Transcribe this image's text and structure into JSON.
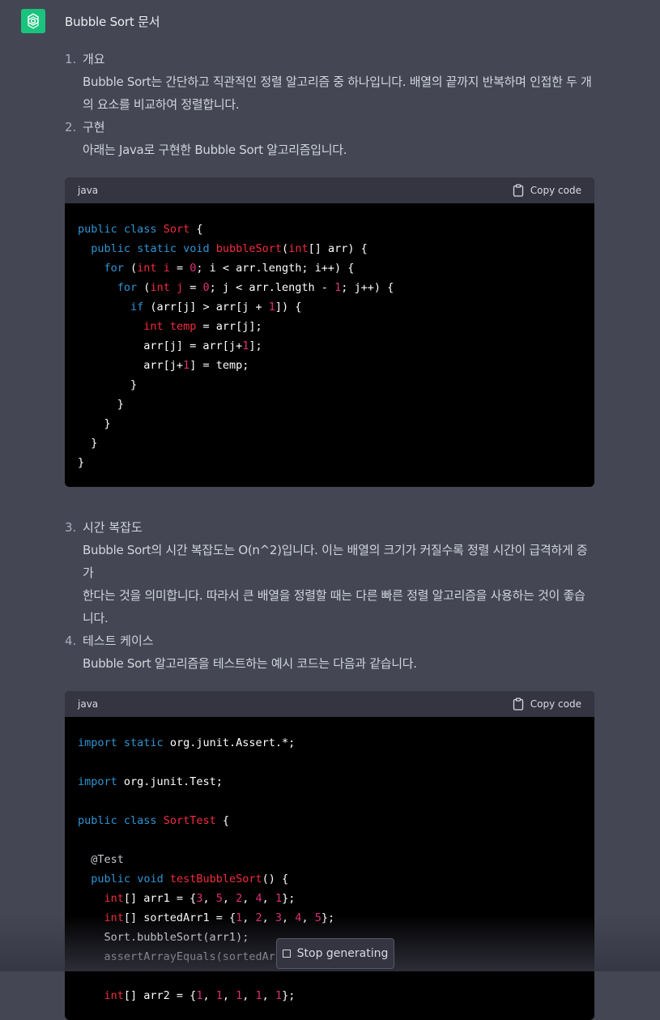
{
  "header": {
    "title": "Bubble Sort 문서",
    "logo_icon": "openai-logo-icon"
  },
  "sections": [
    {
      "num": "1.",
      "heading": "개요",
      "lines": [
        "Bubble Sort는 간단하고 직관적인 정렬 알고리즘 중 하나입니다. 배열의 끝까지 반복하며 인접한 두 개",
        "의 요소를 비교하여 정렬합니다."
      ]
    },
    {
      "num": "2.",
      "heading": "구현",
      "lines": [
        "아래는 Java로 구현한 Bubble Sort 알고리즘입니다."
      ]
    },
    {
      "num": "3.",
      "heading": "시간 복잡도",
      "lines": [
        "Bubble Sort의 시간 복잡도는 O(n^2)입니다. 이는 배열의 크기가 커질수록 정렬 시간이 급격하게 증가",
        "한다는 것을 의미합니다. 따라서 큰 배열을 정렬할 때는 다른 빠른 정렬 알고리즘을 사용하는 것이 좋습",
        "니다."
      ]
    },
    {
      "num": "4.",
      "heading": "테스트 케이스",
      "lines": [
        "Bubble Sort 알고리즘을 테스트하는 예시 코드는 다음과 같습니다."
      ]
    }
  ],
  "code_blocks": [
    {
      "lang": "java",
      "copy_label": "Copy code",
      "lines": [
        [
          [
            "kw",
            "public"
          ],
          [
            "t",
            " "
          ],
          [
            "kw",
            "class"
          ],
          [
            "t",
            " "
          ],
          [
            "cls",
            "Sort"
          ],
          [
            "t",
            " {"
          ]
        ],
        [
          [
            "t",
            "  "
          ],
          [
            "kw",
            "public"
          ],
          [
            "t",
            " "
          ],
          [
            "kw",
            "static"
          ],
          [
            "t",
            " "
          ],
          [
            "kw",
            "void"
          ],
          [
            "t",
            " "
          ],
          [
            "cls",
            "bubbleSort"
          ],
          [
            "t",
            "("
          ],
          [
            "cls",
            "int"
          ],
          [
            "t",
            "[] arr) {"
          ]
        ],
        [
          [
            "t",
            "    "
          ],
          [
            "kw",
            "for"
          ],
          [
            "t",
            " ("
          ],
          [
            "cls",
            "int"
          ],
          [
            "t",
            " "
          ],
          [
            "cls",
            "i"
          ],
          [
            "t",
            " = "
          ],
          [
            "num",
            "0"
          ],
          [
            "t",
            "; i < arr.length; i++) {"
          ]
        ],
        [
          [
            "t",
            "      "
          ],
          [
            "kw",
            "for"
          ],
          [
            "t",
            " ("
          ],
          [
            "cls",
            "int"
          ],
          [
            "t",
            " "
          ],
          [
            "cls",
            "j"
          ],
          [
            "t",
            " = "
          ],
          [
            "num",
            "0"
          ],
          [
            "t",
            "; j < arr.length - "
          ],
          [
            "num",
            "1"
          ],
          [
            "t",
            "; j++) {"
          ]
        ],
        [
          [
            "t",
            "        "
          ],
          [
            "kw",
            "if"
          ],
          [
            "t",
            " (arr[j] > arr[j + "
          ],
          [
            "num",
            "1"
          ],
          [
            "t",
            "]) {"
          ]
        ],
        [
          [
            "t",
            "          "
          ],
          [
            "cls",
            "int"
          ],
          [
            "t",
            " "
          ],
          [
            "cls",
            "temp"
          ],
          [
            "t",
            " = arr[j];"
          ]
        ],
        [
          [
            "t",
            "          arr[j] = arr[j+"
          ],
          [
            "num",
            "1"
          ],
          [
            "t",
            "];"
          ]
        ],
        [
          [
            "t",
            "          arr[j+"
          ],
          [
            "num",
            "1"
          ],
          [
            "t",
            "] = temp;"
          ]
        ],
        [
          [
            "t",
            "        }"
          ]
        ],
        [
          [
            "t",
            "      }"
          ]
        ],
        [
          [
            "t",
            "    }"
          ]
        ],
        [
          [
            "t",
            "  }"
          ]
        ],
        [
          [
            "t",
            "}"
          ]
        ]
      ]
    },
    {
      "lang": "java",
      "copy_label": "Copy code",
      "lines": [
        [
          [
            "kw",
            "import"
          ],
          [
            "t",
            " "
          ],
          [
            "kw",
            "static"
          ],
          [
            "t",
            " org.junit.Assert.*;"
          ]
        ],
        [],
        [
          [
            "kw",
            "import"
          ],
          [
            "t",
            " org.junit.Test;"
          ]
        ],
        [],
        [
          [
            "kw",
            "public"
          ],
          [
            "t",
            " "
          ],
          [
            "kw",
            "class"
          ],
          [
            "t",
            " "
          ],
          [
            "cls",
            "SortTest"
          ],
          [
            "t",
            " {"
          ]
        ],
        [],
        [
          [
            "t",
            "  "
          ],
          [
            "ann",
            "@Test"
          ]
        ],
        [
          [
            "t",
            "  "
          ],
          [
            "kw",
            "public"
          ],
          [
            "t",
            " "
          ],
          [
            "kw",
            "void"
          ],
          [
            "t",
            " "
          ],
          [
            "cls",
            "testBubbleSort"
          ],
          [
            "t",
            "() {"
          ]
        ],
        [
          [
            "t",
            "    "
          ],
          [
            "cls",
            "int"
          ],
          [
            "t",
            "[] arr1 = {"
          ],
          [
            "num",
            "3"
          ],
          [
            "t",
            ", "
          ],
          [
            "num",
            "5"
          ],
          [
            "t",
            ", "
          ],
          [
            "num",
            "2"
          ],
          [
            "t",
            ", "
          ],
          [
            "num",
            "4"
          ],
          [
            "t",
            ", "
          ],
          [
            "num",
            "1"
          ],
          [
            "t",
            "};"
          ]
        ],
        [
          [
            "t",
            "    "
          ],
          [
            "cls",
            "int"
          ],
          [
            "t",
            "[] sortedArr1 = {"
          ],
          [
            "num",
            "1"
          ],
          [
            "t",
            ", "
          ],
          [
            "num",
            "2"
          ],
          [
            "t",
            ", "
          ],
          [
            "num",
            "3"
          ],
          [
            "t",
            ", "
          ],
          [
            "num",
            "4"
          ],
          [
            "t",
            ", "
          ],
          [
            "num",
            "5"
          ],
          [
            "t",
            "};"
          ]
        ],
        [
          [
            "t",
            "    Sort.bubbleSort(arr1);"
          ]
        ],
        [
          [
            "t",
            "    assertArrayEquals(sortedArr1, arr1);"
          ]
        ],
        [],
        [
          [
            "t",
            "    "
          ],
          [
            "cls",
            "int"
          ],
          [
            "t",
            "[] arr2 = {"
          ],
          [
            "num",
            "1"
          ],
          [
            "t",
            ", "
          ],
          [
            "num",
            "1"
          ],
          [
            "t",
            ", "
          ],
          [
            "num",
            "1"
          ],
          [
            "t",
            ", "
          ],
          [
            "num",
            "1"
          ],
          [
            "t",
            ", "
          ],
          [
            "num",
            "1"
          ],
          [
            "t",
            "};"
          ]
        ]
      ]
    }
  ],
  "stop_button": {
    "label": "Stop generating",
    "icon": "stop-square-icon"
  },
  "colors": {
    "background": "#444654",
    "code_bg": "#000000",
    "code_header_bg": "#343541",
    "logo_green": "#19c37d",
    "keyword": "#2e95d3",
    "class_name": "#f22c3d",
    "number": "#df3079"
  }
}
